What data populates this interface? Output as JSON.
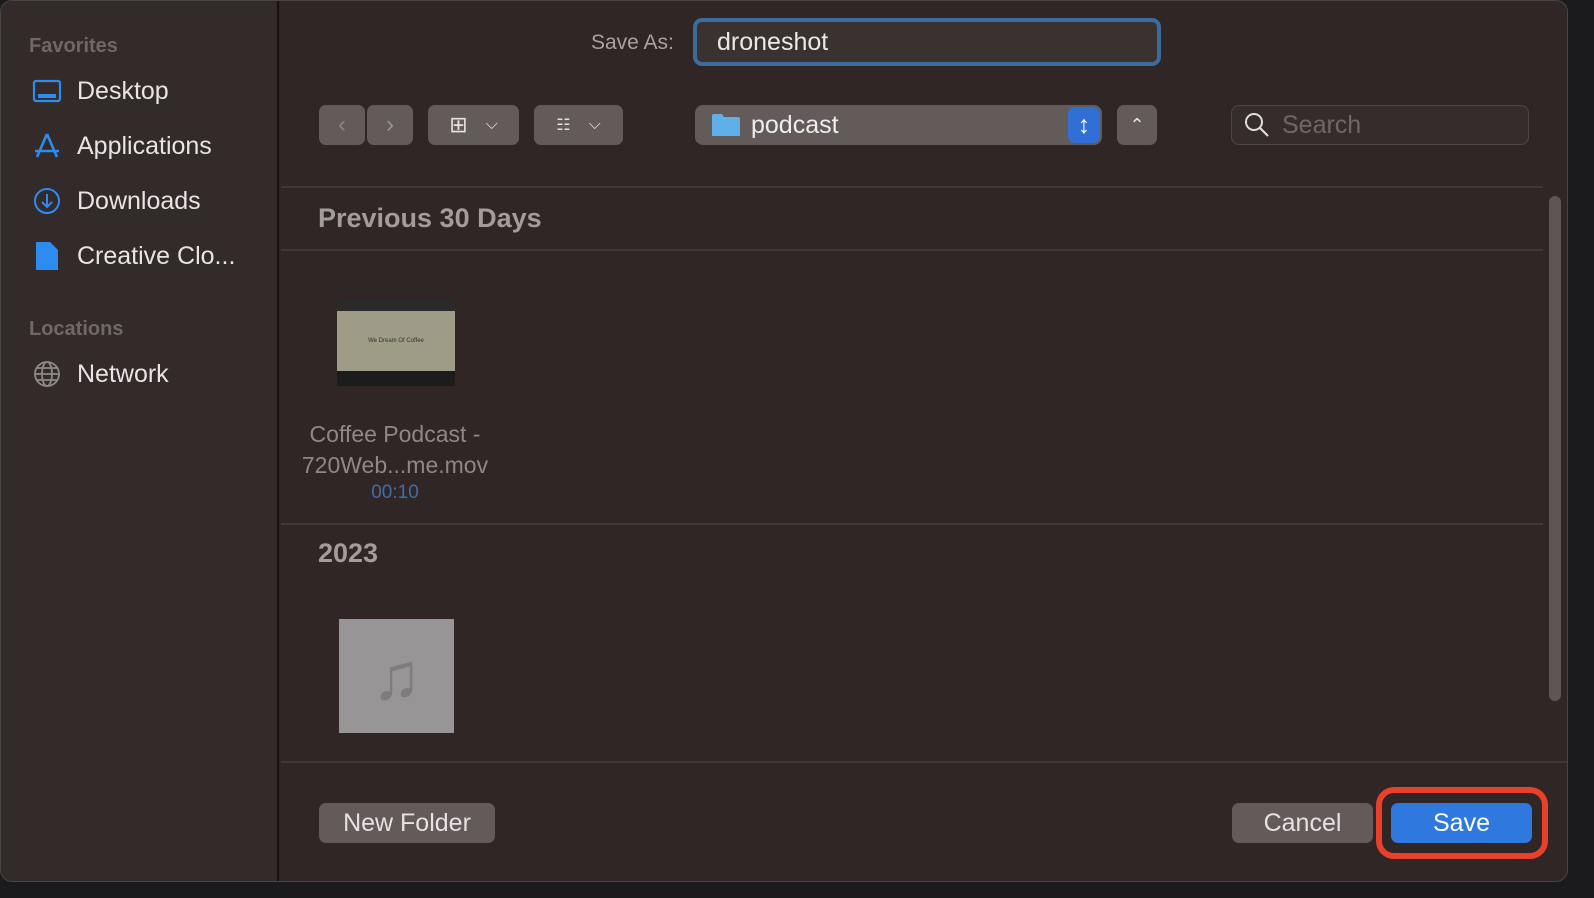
{
  "sidebar": {
    "favorites_label": "Favorites",
    "locations_label": "Locations",
    "favorites": [
      {
        "label": "Desktop",
        "icon": "desktop-icon"
      },
      {
        "label": "Applications",
        "icon": "applications-icon"
      },
      {
        "label": "Downloads",
        "icon": "downloads-icon"
      },
      {
        "label": "Creative Clo...",
        "icon": "document-icon"
      }
    ],
    "locations": [
      {
        "label": "Network",
        "icon": "globe-icon"
      }
    ]
  },
  "header": {
    "save_as_label": "Save As:",
    "filename": "droneshot",
    "location": "podcast",
    "search_placeholder": "Search"
  },
  "list": {
    "sections": [
      {
        "title": "Previous 30 Days",
        "files": [
          {
            "name_line1": "Coffee Podcast -",
            "name_line2": "720Web...me.mov",
            "duration": "00:10",
            "thumb_text": "We Dream Of Coffee"
          }
        ]
      },
      {
        "title": "2023"
      }
    ]
  },
  "footer": {
    "new_folder": "New Folder",
    "cancel": "Cancel",
    "save": "Save"
  },
  "colors": {
    "accent": "#2f6fd6",
    "highlight": "#e8402a"
  }
}
